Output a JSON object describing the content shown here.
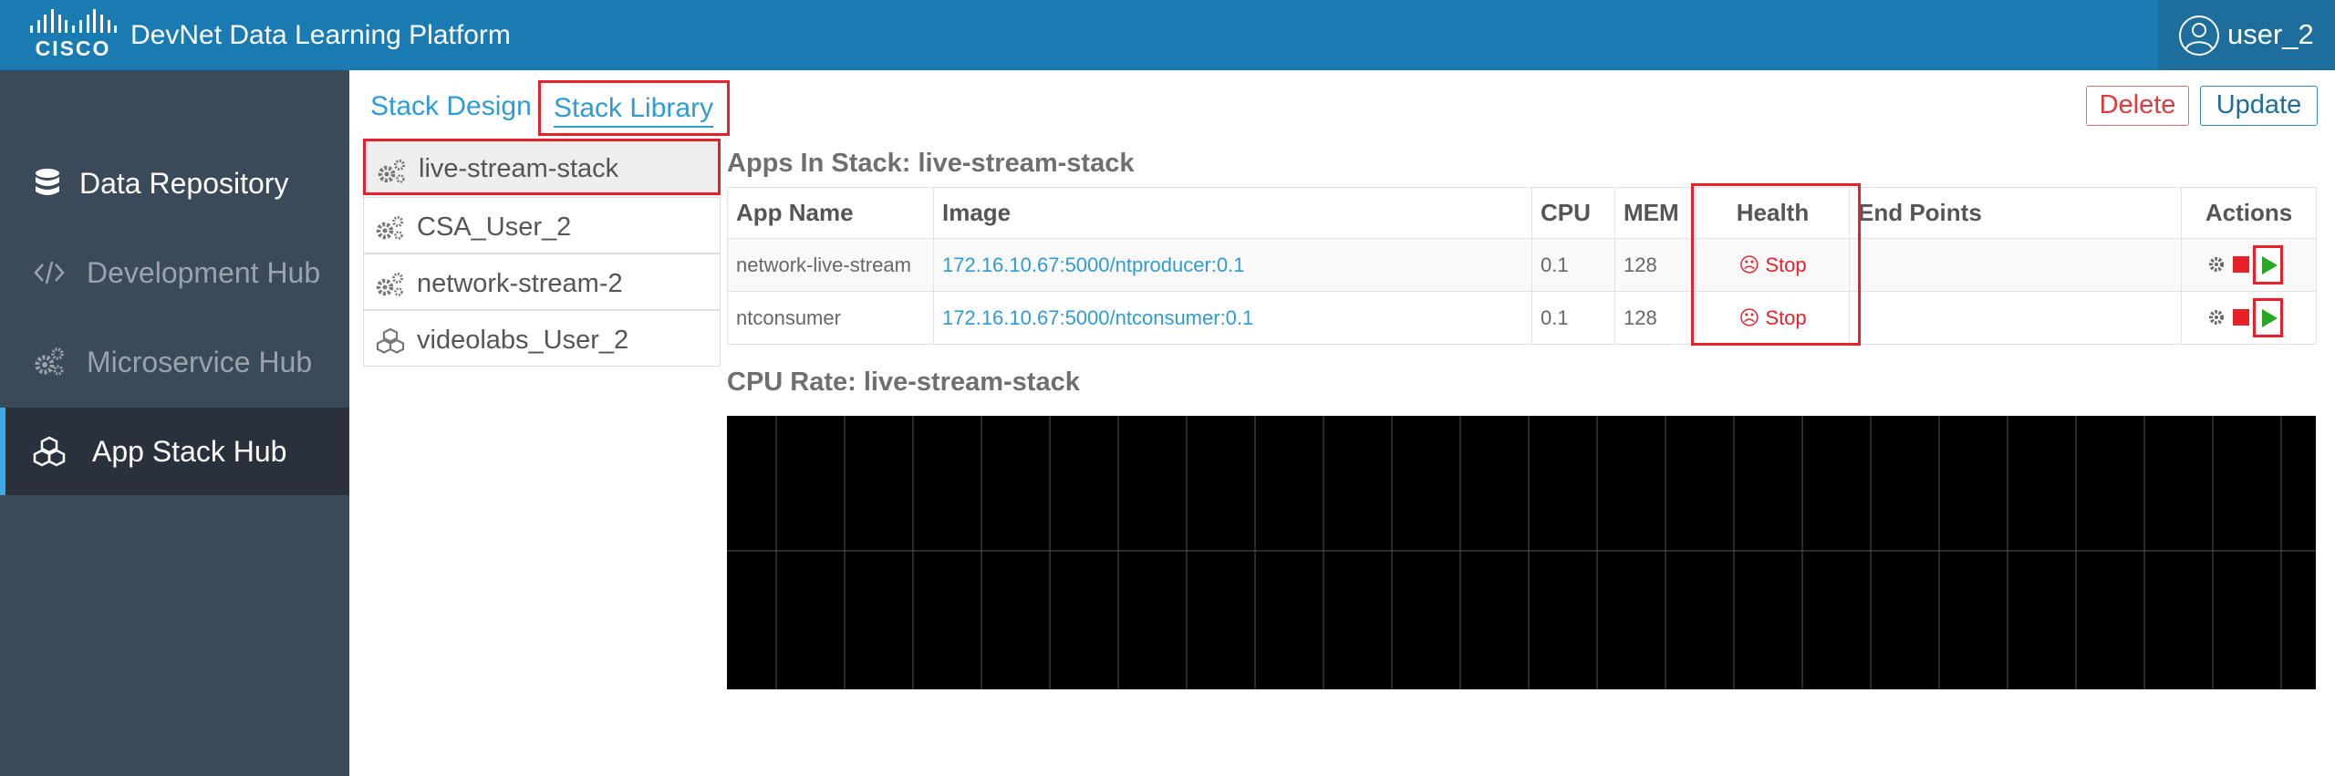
{
  "header": {
    "logo_text": "CISCO",
    "title": "DevNet Data Learning Platform",
    "user_name": "user_2"
  },
  "sidebar": {
    "items": [
      {
        "label": "Data Repository",
        "icon": "database-icon",
        "active": false
      },
      {
        "label": "Development Hub",
        "icon": "code-icon",
        "active": false
      },
      {
        "label": "Microservice Hub",
        "icon": "gears-icon",
        "active": false
      },
      {
        "label": "App Stack Hub",
        "icon": "cubes-icon",
        "active": true
      }
    ]
  },
  "tabs": {
    "design": "Stack Design",
    "library": "Stack Library",
    "active": "Stack Library"
  },
  "actions": {
    "delete": "Delete",
    "update": "Update"
  },
  "stacks": [
    {
      "name": "live-stream-stack",
      "icon": "gears-icon",
      "selected": true
    },
    {
      "name": "CSA_User_2",
      "icon": "gears-icon",
      "selected": false
    },
    {
      "name": "network-stream-2",
      "icon": "gears-icon",
      "selected": false
    },
    {
      "name": "videolabs_User_2",
      "icon": "cubes-icon",
      "selected": false
    }
  ],
  "apps_section": {
    "title": "Apps In Stack: live-stream-stack",
    "columns": [
      "App Name",
      "Image",
      "CPU",
      "MEM",
      "Health",
      "End Points",
      "Actions"
    ],
    "rows": [
      {
        "app_name": "network-live-stream",
        "image": "172.16.10.67:5000/ntproducer:0.1",
        "cpu": "0.1",
        "mem": "128",
        "health": "Stop",
        "end_points": ""
      },
      {
        "app_name": "ntconsumer",
        "image": "172.16.10.67:5000/ntconsumer:0.1",
        "cpu": "0.1",
        "mem": "128",
        "health": "Stop",
        "end_points": ""
      }
    ]
  },
  "cpu_section": {
    "title": "CPU Rate: live-stream-stack"
  },
  "colors": {
    "header_bg": "#1a7bb2",
    "sidebar_bg": "#3b4a58",
    "sidebar_active_bg": "#29323c",
    "accent": "#3dabe8",
    "highlight_red": "#e8202a",
    "link_blue": "#2f9bd6",
    "play_green": "#26a826",
    "chart_bg": "#000000"
  },
  "chart_data": {
    "type": "line",
    "title": "CPU Rate: live-stream-stack",
    "series": [],
    "grid": true
  }
}
